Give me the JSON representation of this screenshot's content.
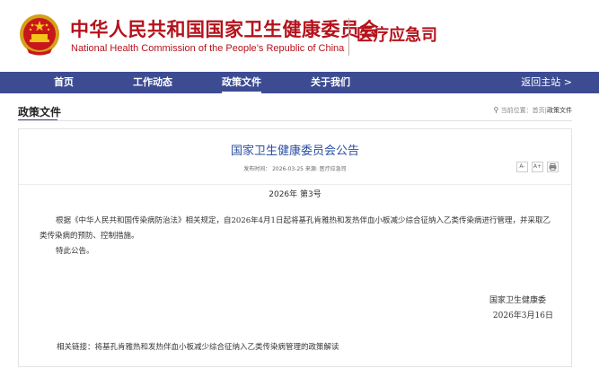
{
  "header": {
    "title_cn": "中华人民共和国国家卫生健康委员会",
    "title_en": "National Health Commission of the People’s Republic of China",
    "department": "医疗应急司"
  },
  "nav": {
    "items": [
      "首页",
      "工作动态",
      "政策文件",
      "关于我们"
    ],
    "active": "政策文件",
    "return_label": "返回主站 >"
  },
  "section": {
    "title": "政策文件",
    "breadcrumb": {
      "prefix": "当前位置：",
      "home": "首页",
      "sep": "|",
      "current": "政策文件"
    }
  },
  "article": {
    "title": "国家卫生健康委员会公告",
    "meta": "发布时间： 2026-03-25   来源: 医疗应急司",
    "tools": [
      "A-",
      "A+",
      "print-icon"
    ],
    "number": "2026年 第3号",
    "paragraph1": "根据《中华人民共和国传染病防治法》相关规定，自2026年4月1日起将基孔肯雅热和发热伴血小板减少综合征纳入乙类传染病进行管理，并采取乙类传染病的预防、控制措施。",
    "paragraph2": "特此公告。",
    "signature_org": "国家卫生健康委",
    "signature_date": "2026年3月16日",
    "related_prefix": "相关链接：",
    "related_link": "将基孔肯雅热和发热伴血小板减少综合征纳入乙类传染病管理的政策解读"
  },
  "colors": {
    "brand_red": "#b5121b",
    "nav_blue": "#3d4c92",
    "title_blue": "#2a4fa0"
  }
}
